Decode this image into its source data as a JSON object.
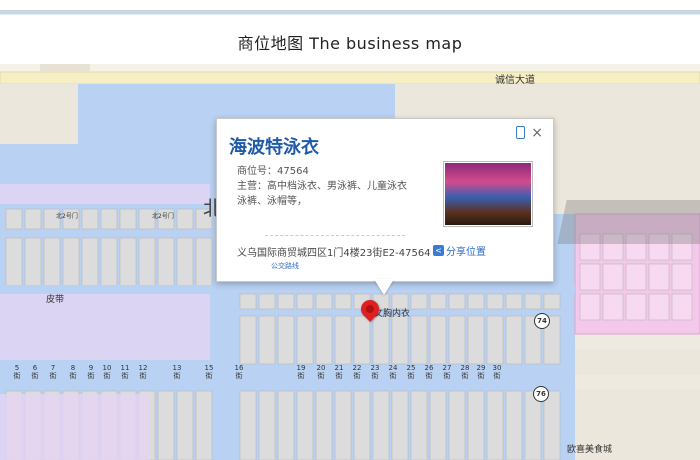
{
  "header": {
    "title": "商位地图 The business map"
  },
  "map": {
    "road_label": "诚信大道",
    "big_char": "北",
    "area_label": "皮带",
    "north_gate_labels": [
      "北2号门",
      "北2号门"
    ],
    "marker_label": "文胸内衣",
    "bottom_label": "欧喜美食城",
    "road_badges": [
      "74",
      "76"
    ],
    "streets": [
      "5街",
      "6街",
      "7街",
      "8街",
      "9街",
      "10街",
      "11街",
      "12街",
      "13街",
      "15街",
      "16街",
      "19街",
      "20街",
      "21街",
      "22街",
      "23街",
      "24街",
      "25街",
      "26街",
      "27街",
      "28街",
      "29街",
      "30街"
    ]
  },
  "popup": {
    "title": "海波特泳衣",
    "booth": "商位号：47564",
    "business": "主营：高中档泳衣、男泳裤、儿童泳衣泳裤、泳帽等，",
    "address": "义乌国际商贸城四区1门4楼23街E2-47564",
    "share": "分享位置",
    "route": "公交路线",
    "close": "×"
  },
  "colors": {
    "water": "#b9d1f2",
    "booth": "#dcdcdc",
    "pink": "#f3c8ea",
    "road_yellow": "#f6eec4",
    "accent": "#1f5aa8"
  }
}
